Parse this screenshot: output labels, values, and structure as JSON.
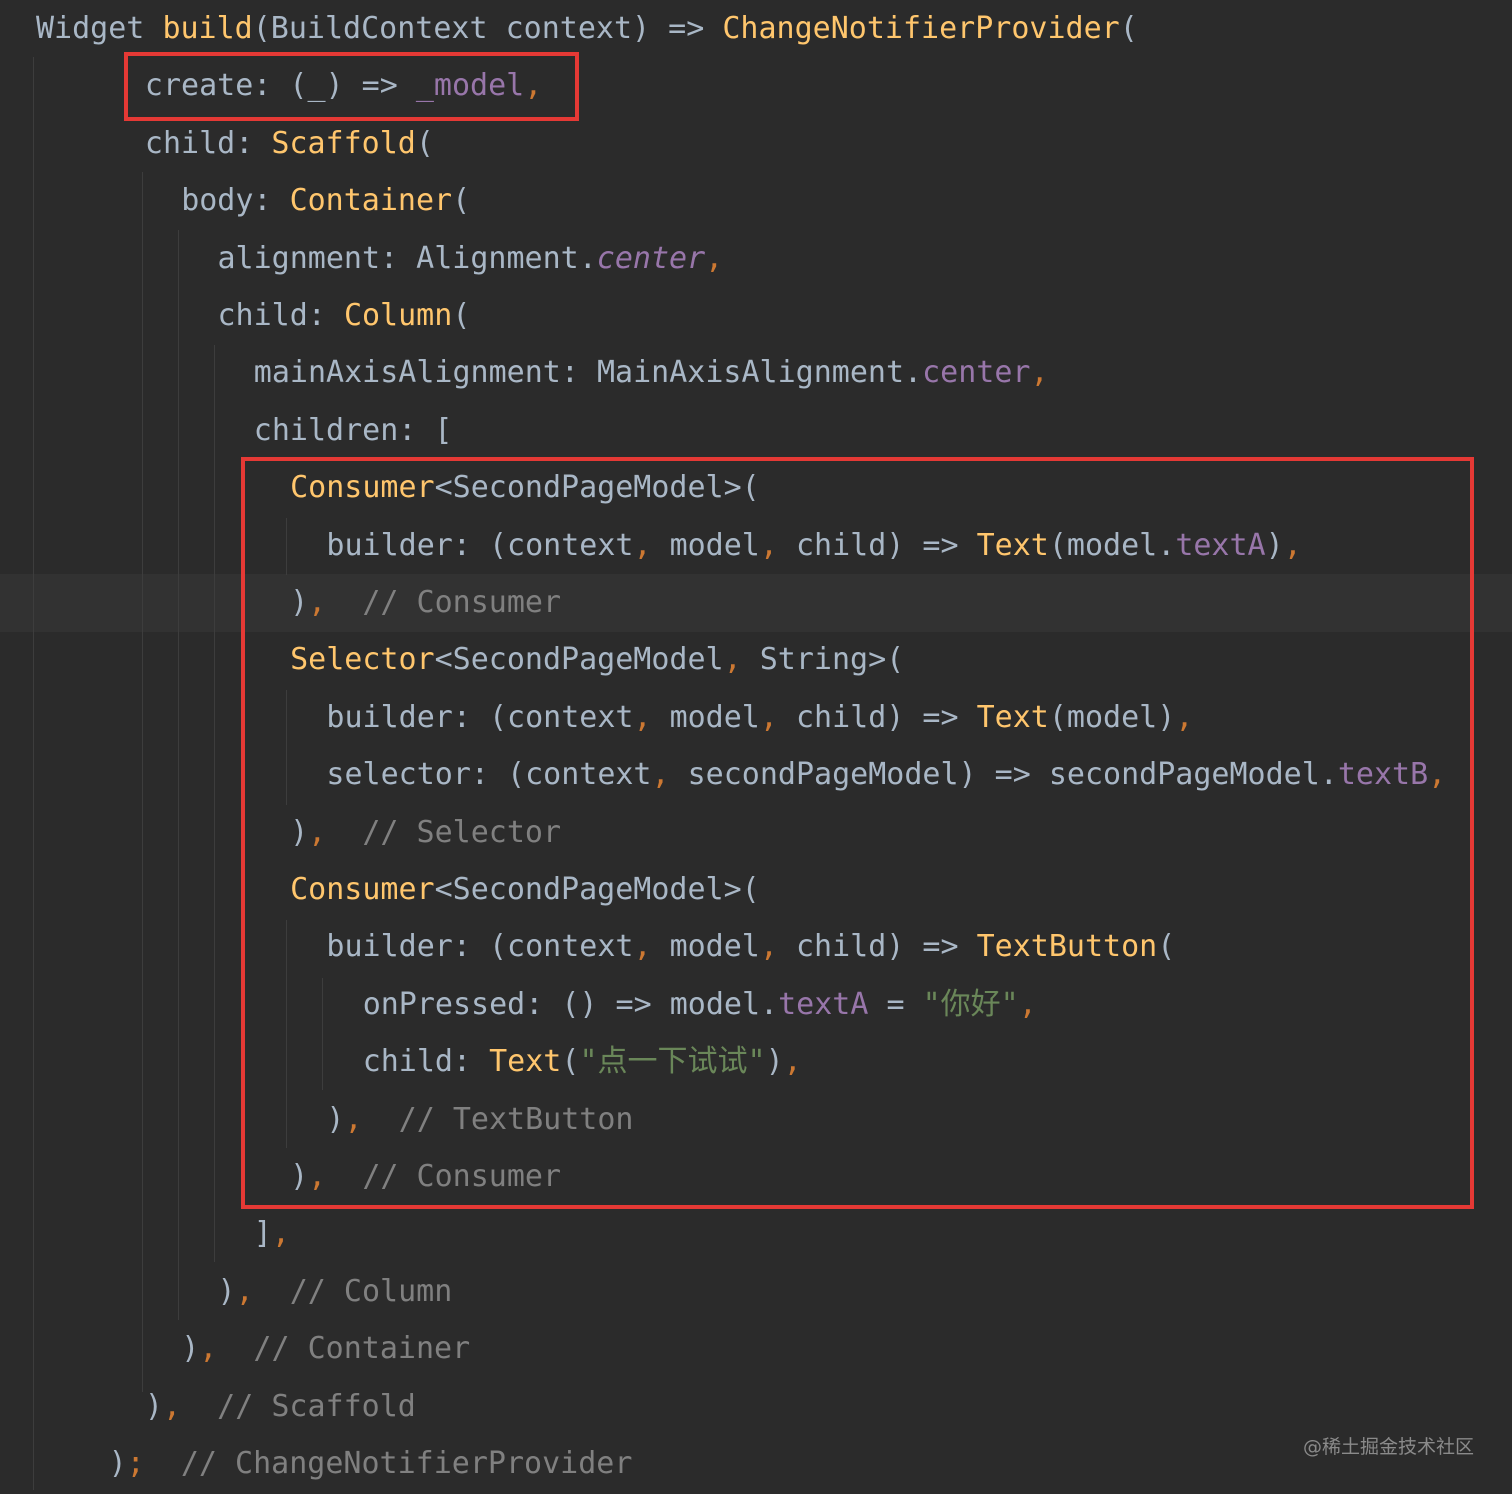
{
  "editor": {
    "lines": [
      {
        "indent": 0,
        "tokens": [
          [
            "Widget ",
            "id"
          ],
          [
            "build",
            "fn"
          ],
          [
            "(BuildContext context) => ",
            "id"
          ],
          [
            "ChangeNotifierProvider",
            "fn"
          ],
          [
            "(",
            "id"
          ]
        ]
      },
      {
        "indent": 3,
        "tokens": [
          [
            "create: (_) => ",
            "id"
          ],
          [
            "_model",
            "prop"
          ],
          [
            ",",
            "punc"
          ]
        ]
      },
      {
        "indent": 3,
        "tokens": [
          [
            "child: ",
            "id"
          ],
          [
            "Scaffold",
            "fn"
          ],
          [
            "(",
            "id"
          ]
        ]
      },
      {
        "indent": 4,
        "tokens": [
          [
            "body: ",
            "id"
          ],
          [
            "Container",
            "fn"
          ],
          [
            "(",
            "id"
          ]
        ]
      },
      {
        "indent": 5,
        "tokens": [
          [
            "alignment: Alignment.",
            "id"
          ],
          [
            "center",
            "prop-i"
          ],
          [
            ",",
            "punc"
          ]
        ]
      },
      {
        "indent": 5,
        "tokens": [
          [
            "child: ",
            "id"
          ],
          [
            "Column",
            "fn"
          ],
          [
            "(",
            "id"
          ]
        ]
      },
      {
        "indent": 6,
        "tokens": [
          [
            "mainAxisAlignment: MainAxisAlignment.",
            "id"
          ],
          [
            "center",
            "prop"
          ],
          [
            ",",
            "punc"
          ]
        ]
      },
      {
        "indent": 6,
        "tokens": [
          [
            "children: [",
            "id"
          ]
        ]
      },
      {
        "indent": 7,
        "tokens": [
          [
            "Consumer",
            "fn"
          ],
          [
            "<SecondPageModel>(",
            "id"
          ]
        ]
      },
      {
        "indent": 8,
        "tokens": [
          [
            "builder: (context",
            "id"
          ],
          [
            ", ",
            "punc"
          ],
          [
            "model",
            "id"
          ],
          [
            ", ",
            "punc"
          ],
          [
            "child) => ",
            "id"
          ],
          [
            "Text",
            "fn"
          ],
          [
            "(model.",
            "id"
          ],
          [
            "textA",
            "prop"
          ],
          [
            ")",
            "id"
          ],
          [
            ",",
            "punc"
          ]
        ]
      },
      {
        "indent": 7,
        "tokens": [
          [
            ")",
            "id"
          ],
          [
            ",",
            "punc"
          ],
          [
            "  // Consumer",
            "com"
          ]
        ]
      },
      {
        "indent": 7,
        "tokens": [
          [
            "Selector",
            "fn"
          ],
          [
            "<SecondPageModel",
            "id"
          ],
          [
            ", ",
            "punc"
          ],
          [
            "String>(",
            "id"
          ]
        ]
      },
      {
        "indent": 8,
        "tokens": [
          [
            "builder: (context",
            "id"
          ],
          [
            ", ",
            "punc"
          ],
          [
            "model",
            "id"
          ],
          [
            ", ",
            "punc"
          ],
          [
            "child) => ",
            "id"
          ],
          [
            "Text",
            "fn"
          ],
          [
            "(model)",
            "id"
          ],
          [
            ",",
            "punc"
          ]
        ]
      },
      {
        "indent": 8,
        "tokens": [
          [
            "selector: (context",
            "id"
          ],
          [
            ", ",
            "punc"
          ],
          [
            "secondPageModel) => secondPageModel.",
            "id"
          ],
          [
            "textB",
            "prop"
          ],
          [
            ",",
            "punc"
          ]
        ]
      },
      {
        "indent": 7,
        "tokens": [
          [
            ")",
            "id"
          ],
          [
            ",",
            "punc"
          ],
          [
            "  // Selector",
            "com"
          ]
        ]
      },
      {
        "indent": 7,
        "tokens": [
          [
            "Consumer",
            "fn"
          ],
          [
            "<SecondPageModel>(",
            "id"
          ]
        ]
      },
      {
        "indent": 8,
        "tokens": [
          [
            "builder: (context",
            "id"
          ],
          [
            ", ",
            "punc"
          ],
          [
            "model",
            "id"
          ],
          [
            ", ",
            "punc"
          ],
          [
            "child) => ",
            "id"
          ],
          [
            "TextButton",
            "fn"
          ],
          [
            "(",
            "id"
          ]
        ]
      },
      {
        "indent": 9,
        "tokens": [
          [
            "onPressed: () => model.",
            "id"
          ],
          [
            "textA",
            "prop"
          ],
          [
            " = ",
            "id"
          ],
          [
            "\"你好\"",
            "str"
          ],
          [
            ",",
            "punc"
          ]
        ]
      },
      {
        "indent": 9,
        "tokens": [
          [
            "child: ",
            "id"
          ],
          [
            "Text",
            "fn"
          ],
          [
            "(",
            "id"
          ],
          [
            "\"点一下试试\"",
            "str"
          ],
          [
            ")",
            "id"
          ],
          [
            ",",
            "punc"
          ]
        ]
      },
      {
        "indent": 8,
        "tokens": [
          [
            ")",
            "id"
          ],
          [
            ",",
            "punc"
          ],
          [
            "  // TextButton",
            "com"
          ]
        ]
      },
      {
        "indent": 7,
        "tokens": [
          [
            ")",
            "id"
          ],
          [
            ",",
            "punc"
          ],
          [
            "  // Consumer",
            "com"
          ]
        ]
      },
      {
        "indent": 6,
        "tokens": [
          [
            "]",
            "id"
          ],
          [
            ",",
            "punc"
          ]
        ]
      },
      {
        "indent": 5,
        "tokens": [
          [
            ")",
            "id"
          ],
          [
            ",",
            "punc"
          ],
          [
            "  // Column",
            "com"
          ]
        ]
      },
      {
        "indent": 4,
        "tokens": [
          [
            ")",
            "id"
          ],
          [
            ",",
            "punc"
          ],
          [
            "  // Container",
            "com"
          ]
        ]
      },
      {
        "indent": 3,
        "tokens": [
          [
            ")",
            "id"
          ],
          [
            ",",
            "punc"
          ],
          [
            "  // Scaffold",
            "com"
          ]
        ]
      },
      {
        "indent": 2,
        "tokens": [
          [
            ")",
            "id"
          ],
          [
            ";",
            "punc"
          ],
          [
            "  // ChangeNotifierProvider",
            "com"
          ]
        ]
      }
    ]
  },
  "watermark": "@稀土掘金技术社区",
  "colors": {
    "background": "#2b2b2b",
    "identifier": "#a9b7c6",
    "function": "#ffc66d",
    "property": "#9876aa",
    "string": "#6a8759",
    "comment": "#808080",
    "punctuation": "#cc7832",
    "annotation_box": "#e53935"
  }
}
